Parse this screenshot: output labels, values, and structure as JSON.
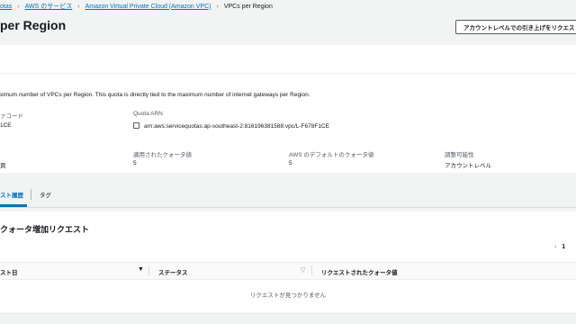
{
  "breadcrumbs": {
    "item1": "otas",
    "item2": "AWS のサービス",
    "item3": "Amazon Virtual Private Cloud (Amazon VPC)",
    "current": "VPCs per Region"
  },
  "header": {
    "title": "per Region",
    "request_button": "アカウントレベルでの引き上げをリクエスト"
  },
  "details": {
    "description": "ximum number of VPCs per Region. This quota is directly tied to the maximum number of internet gateways per Region.",
    "code_label": "ァコード",
    "code_value": "1CE",
    "arn_label": "Quota ARN",
    "arn_value": "arn:aws:servicequotas:ap-southeast-2:816196381588:vpc/L-F678F1CE",
    "row2_col1_value": "頁",
    "applied_label": "適用されたクォータ値",
    "applied_value": "5",
    "default_label": "AWS のデフォルトのクォータ値",
    "default_value": "5",
    "adjustable_label": "調整可能性",
    "adjustable_value": "アカウントレベル"
  },
  "tabs": {
    "history": "スト履歴",
    "tags": "タグ"
  },
  "requests": {
    "title": "クォータ増加リクエスト",
    "page": "1",
    "columns": {
      "date": "スト日",
      "status": "ステータス",
      "requested_value": "リクエストされたクォータ値"
    },
    "empty": "リクエストが見つかりません"
  }
}
